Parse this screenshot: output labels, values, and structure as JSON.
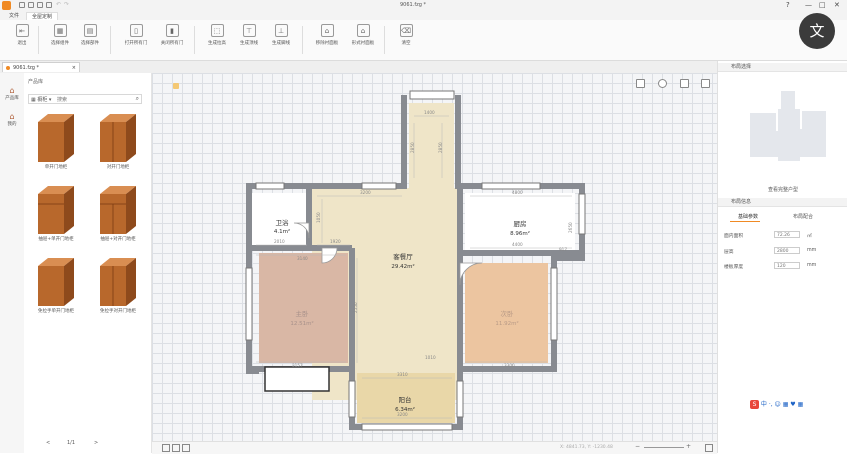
{
  "window": {
    "title": "9061.fzg *",
    "controls": [
      "?",
      "—",
      "□",
      "✕"
    ]
  },
  "menu": {
    "tabs": [
      {
        "label": "文件",
        "active": false
      },
      {
        "label": "全屋定制",
        "active": true
      }
    ]
  },
  "ribbon": {
    "buttons": [
      "退出",
      "选择组件",
      "选择部件",
      "打开所有门",
      "关闭所有门",
      "生成拉高",
      "生成顶线",
      "生成脚线",
      "移除衬面板",
      "形式衬面板",
      "清空"
    ]
  },
  "document_tab": {
    "label": "9061.fzg *",
    "close": "×"
  },
  "left_rail": {
    "items": [
      "产品库",
      "我的"
    ]
  },
  "library": {
    "heading": "产品库",
    "category": "橱柜",
    "search_placeholder": "搜索",
    "products": [
      {
        "label": "单开门地柜"
      },
      {
        "label": "对开门地柜"
      },
      {
        "label": "抽屉+单开门地柜"
      },
      {
        "label": "抽屉+对开门地柜"
      },
      {
        "label": "免拉手单开门地柜"
      },
      {
        "label": "免拉手对开门地柜"
      }
    ],
    "pager": {
      "prev": "<",
      "text": "1/1",
      "next": ">"
    }
  },
  "floorplan": {
    "rooms": [
      {
        "name": "卫浴",
        "area": "4.1m²"
      },
      {
        "name": "厨房",
        "area": "8.96m²"
      },
      {
        "name": "客餐厅",
        "area": "29.42m²"
      },
      {
        "name": "主卧",
        "area": "12.51m²"
      },
      {
        "name": "次卧",
        "area": "11.92m²"
      },
      {
        "name": "阳台",
        "area": "6.34m²"
      }
    ],
    "dimensions": [
      "1400",
      "2850",
      "4800",
      "3200",
      "2850",
      "2550",
      "4400",
      "3140",
      "3300",
      "1920",
      "3157",
      "3310",
      "3200",
      "2010",
      "1050",
      "917",
      "1010",
      "2650"
    ]
  },
  "canvas_status": {
    "coordinates": "X: 4841.73, Y: -1230.48",
    "zoom_minus": "−",
    "zoom_plus": "+"
  },
  "right_panel": {
    "sections": {
      "preview": "布局选择",
      "properties": "布局信息"
    },
    "preview_button": "查看完整户型",
    "tabs": [
      "基础参数",
      "布局配合"
    ],
    "props": [
      {
        "label": "面内面积",
        "value": "72.26",
        "unit": "㎡"
      },
      {
        "label": "层高",
        "value": "2800",
        "unit": "mm"
      },
      {
        "label": "楼板厚度",
        "value": "120",
        "unit": "mm"
      }
    ],
    "ime_text": "中 ·, ☺ ▦ ♥ ▦"
  },
  "overlay": {
    "translate_icon": "文"
  },
  "colors": {
    "accent": "#f08a24",
    "wall": "#888b91",
    "living_floor": "#efe5c8",
    "master_floor": "#d9b7a5",
    "second_floor": "#ecc5a0",
    "wood": "#b8682c"
  }
}
